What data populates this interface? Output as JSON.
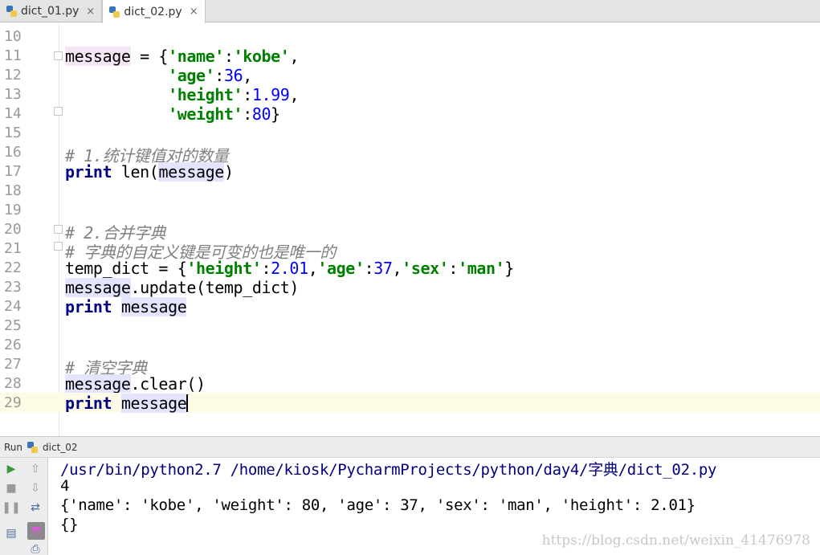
{
  "tabs": [
    {
      "label": "dict_01.py",
      "close": "×",
      "active": false
    },
    {
      "label": "dict_02.py",
      "close": "×",
      "active": true
    }
  ],
  "editor": {
    "line_numbers": [
      "10",
      "11",
      "12",
      "13",
      "14",
      "15",
      "16",
      "17",
      "18",
      "19",
      "20",
      "21",
      "22",
      "23",
      "24",
      "25",
      "26",
      "27",
      "28",
      "29"
    ],
    "current_line": "29"
  },
  "run": {
    "label": "Run",
    "config": "dict_02",
    "output": [
      "/usr/bin/python2.7 /home/kiosk/PycharmProjects/python/day4/字典/dict_02.py",
      "4",
      "{'name': 'kobe', 'weight': 80, 'age': 37, 'sex': 'man', 'height': 2.01}",
      "{}"
    ]
  },
  "watermark": "https://blog.csdn.net/weixin_41476978",
  "colors": {
    "keyword": "#000080",
    "string": "#008000",
    "number": "#0000ff",
    "comment": "#808080",
    "current_line": "#fdfbe6"
  }
}
